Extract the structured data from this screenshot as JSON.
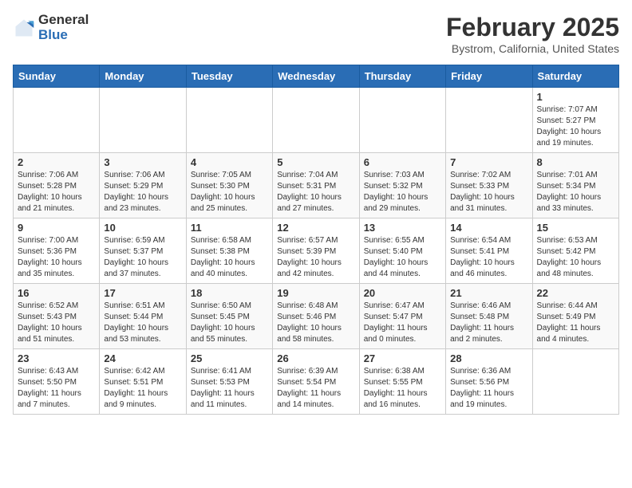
{
  "header": {
    "logo_general": "General",
    "logo_blue": "Blue",
    "month_title": "February 2025",
    "location": "Bystrom, California, United States"
  },
  "calendar": {
    "weekdays": [
      "Sunday",
      "Monday",
      "Tuesday",
      "Wednesday",
      "Thursday",
      "Friday",
      "Saturday"
    ],
    "weeks": [
      [
        {
          "day": "",
          "info": ""
        },
        {
          "day": "",
          "info": ""
        },
        {
          "day": "",
          "info": ""
        },
        {
          "day": "",
          "info": ""
        },
        {
          "day": "",
          "info": ""
        },
        {
          "day": "",
          "info": ""
        },
        {
          "day": "1",
          "info": "Sunrise: 7:07 AM\nSunset: 5:27 PM\nDaylight: 10 hours\nand 19 minutes."
        }
      ],
      [
        {
          "day": "2",
          "info": "Sunrise: 7:06 AM\nSunset: 5:28 PM\nDaylight: 10 hours\nand 21 minutes."
        },
        {
          "day": "3",
          "info": "Sunrise: 7:06 AM\nSunset: 5:29 PM\nDaylight: 10 hours\nand 23 minutes."
        },
        {
          "day": "4",
          "info": "Sunrise: 7:05 AM\nSunset: 5:30 PM\nDaylight: 10 hours\nand 25 minutes."
        },
        {
          "day": "5",
          "info": "Sunrise: 7:04 AM\nSunset: 5:31 PM\nDaylight: 10 hours\nand 27 minutes."
        },
        {
          "day": "6",
          "info": "Sunrise: 7:03 AM\nSunset: 5:32 PM\nDaylight: 10 hours\nand 29 minutes."
        },
        {
          "day": "7",
          "info": "Sunrise: 7:02 AM\nSunset: 5:33 PM\nDaylight: 10 hours\nand 31 minutes."
        },
        {
          "day": "8",
          "info": "Sunrise: 7:01 AM\nSunset: 5:34 PM\nDaylight: 10 hours\nand 33 minutes."
        }
      ],
      [
        {
          "day": "9",
          "info": "Sunrise: 7:00 AM\nSunset: 5:36 PM\nDaylight: 10 hours\nand 35 minutes."
        },
        {
          "day": "10",
          "info": "Sunrise: 6:59 AM\nSunset: 5:37 PM\nDaylight: 10 hours\nand 37 minutes."
        },
        {
          "day": "11",
          "info": "Sunrise: 6:58 AM\nSunset: 5:38 PM\nDaylight: 10 hours\nand 40 minutes."
        },
        {
          "day": "12",
          "info": "Sunrise: 6:57 AM\nSunset: 5:39 PM\nDaylight: 10 hours\nand 42 minutes."
        },
        {
          "day": "13",
          "info": "Sunrise: 6:55 AM\nSunset: 5:40 PM\nDaylight: 10 hours\nand 44 minutes."
        },
        {
          "day": "14",
          "info": "Sunrise: 6:54 AM\nSunset: 5:41 PM\nDaylight: 10 hours\nand 46 minutes."
        },
        {
          "day": "15",
          "info": "Sunrise: 6:53 AM\nSunset: 5:42 PM\nDaylight: 10 hours\nand 48 minutes."
        }
      ],
      [
        {
          "day": "16",
          "info": "Sunrise: 6:52 AM\nSunset: 5:43 PM\nDaylight: 10 hours\nand 51 minutes."
        },
        {
          "day": "17",
          "info": "Sunrise: 6:51 AM\nSunset: 5:44 PM\nDaylight: 10 hours\nand 53 minutes."
        },
        {
          "day": "18",
          "info": "Sunrise: 6:50 AM\nSunset: 5:45 PM\nDaylight: 10 hours\nand 55 minutes."
        },
        {
          "day": "19",
          "info": "Sunrise: 6:48 AM\nSunset: 5:46 PM\nDaylight: 10 hours\nand 58 minutes."
        },
        {
          "day": "20",
          "info": "Sunrise: 6:47 AM\nSunset: 5:47 PM\nDaylight: 11 hours\nand 0 minutes."
        },
        {
          "day": "21",
          "info": "Sunrise: 6:46 AM\nSunset: 5:48 PM\nDaylight: 11 hours\nand 2 minutes."
        },
        {
          "day": "22",
          "info": "Sunrise: 6:44 AM\nSunset: 5:49 PM\nDaylight: 11 hours\nand 4 minutes."
        }
      ],
      [
        {
          "day": "23",
          "info": "Sunrise: 6:43 AM\nSunset: 5:50 PM\nDaylight: 11 hours\nand 7 minutes."
        },
        {
          "day": "24",
          "info": "Sunrise: 6:42 AM\nSunset: 5:51 PM\nDaylight: 11 hours\nand 9 minutes."
        },
        {
          "day": "25",
          "info": "Sunrise: 6:41 AM\nSunset: 5:53 PM\nDaylight: 11 hours\nand 11 minutes."
        },
        {
          "day": "26",
          "info": "Sunrise: 6:39 AM\nSunset: 5:54 PM\nDaylight: 11 hours\nand 14 minutes."
        },
        {
          "day": "27",
          "info": "Sunrise: 6:38 AM\nSunset: 5:55 PM\nDaylight: 11 hours\nand 16 minutes."
        },
        {
          "day": "28",
          "info": "Sunrise: 6:36 AM\nSunset: 5:56 PM\nDaylight: 11 hours\nand 19 minutes."
        },
        {
          "day": "",
          "info": ""
        }
      ]
    ]
  }
}
